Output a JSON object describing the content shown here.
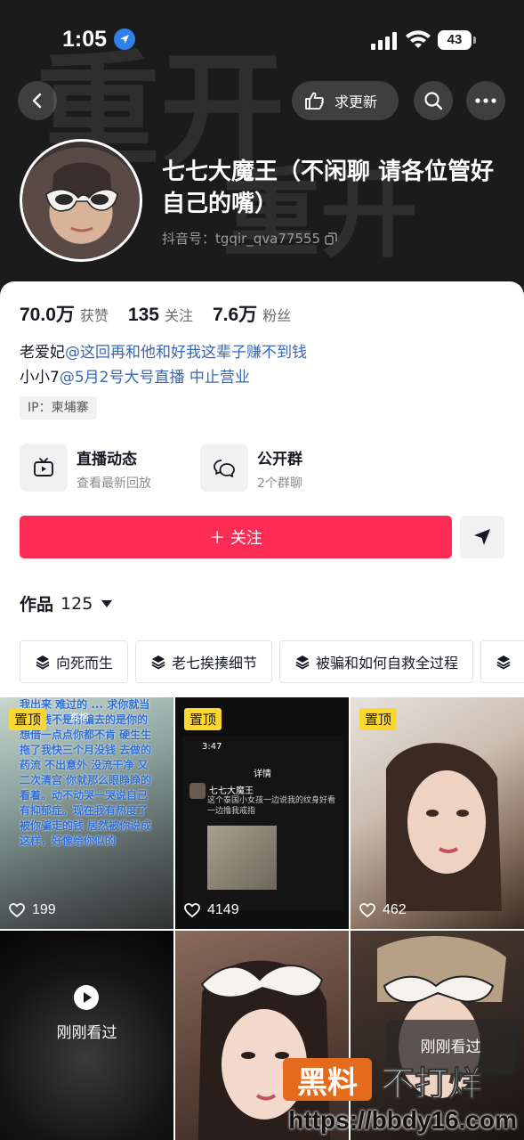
{
  "status_bar": {
    "time": "1:05",
    "battery": "43"
  },
  "header": {
    "background_text": "重开",
    "refresh_label": "求更新",
    "nickname": "七七大魔王（不闲聊 请各位管好自己的嘴）",
    "douyin_id_label": "抖音号：",
    "douyin_id": "tgqir_qva77555"
  },
  "stats": [
    {
      "value": "70.0万",
      "label": "获赞"
    },
    {
      "value": "135",
      "label": "关注"
    },
    {
      "value": "7.6万",
      "label": "粉丝"
    }
  ],
  "bio": {
    "line1_prefix": "老爱妃",
    "line1_mention": "@这回再和他和好我这辈子赚不到钱",
    "line2_prefix": "小小7",
    "line2_mention": "@5月2号大号直播 中止营业"
  },
  "ip_tag": "IP：柬埔寨",
  "features": [
    {
      "title": "直播动态",
      "subtitle": "查看最新回放",
      "icon": "tv-icon"
    },
    {
      "title": "公开群",
      "subtitle": "2个群聊",
      "icon": "chat-icon"
    }
  ],
  "follow_label": "＋ 关注",
  "works": {
    "label": "作品",
    "count": "125"
  },
  "collections": [
    "向死而生",
    "老七挨揍细节",
    "被骗和如何自救全过程"
  ],
  "videos": [
    {
      "pinned": "置顶",
      "likes": "199",
      "overlay": "我出来 难过的 ... 求你就当这个钱不是你骗去的是你的 想借一点点你都不肯 硬生生拖了我快三个月没钱 去做的药流 不出意外 没流干净 又二次清宫 你就那么眼睁睁的看着。动不动哭一哭说自己有抑郁症。现在我有热度了 被你骗走的钱 居然被你说成这样，好像给你似的",
      "overlay_top": "资格"
    },
    {
      "pinned": "置顶",
      "likes": "4149",
      "screen_time": "3:47",
      "screen_title": "详情",
      "screen_user": "七七大魔王",
      "screen_caption": "这个泰国小女孩一边说我的纹身好看 一边撸我戒指"
    },
    {
      "pinned": "置顶",
      "likes": "462"
    },
    {
      "watched": "刚刚看过"
    },
    {},
    {
      "watched": "刚刚看过"
    }
  ],
  "watermark": {
    "logo": "黑料",
    "text": "不打烊",
    "url": "https://bbdy16.com"
  }
}
